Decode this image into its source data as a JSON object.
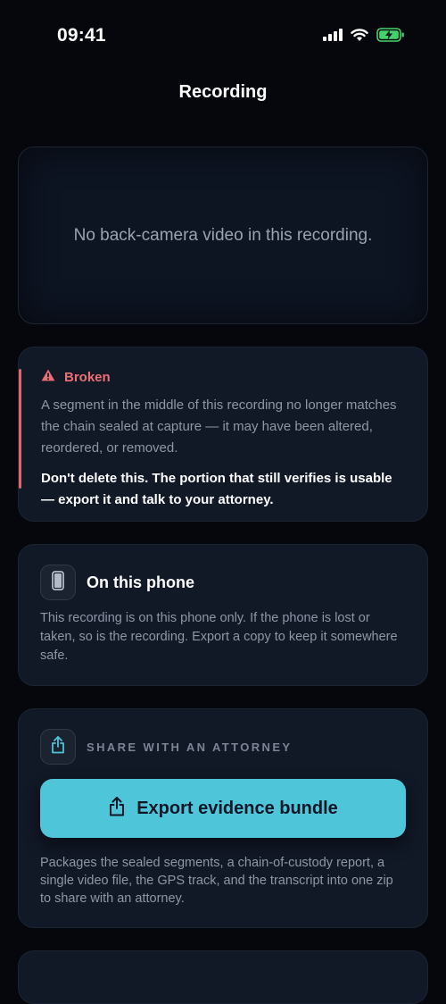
{
  "status_bar": {
    "time": "09:41",
    "icons": [
      "cellular-signal-icon",
      "wifi-icon",
      "battery-charging-icon"
    ]
  },
  "nav": {
    "title": "Recording"
  },
  "video": {
    "message": "No back-camera video in this recording."
  },
  "integrity": {
    "status_label": "Broken",
    "status_icon": "warning-triangle-icon",
    "status_color": "#ec6f76",
    "description": "A segment in the middle of this recording no longer matches the chain sealed at capture — it may have been altered, reordered, or removed.",
    "advice": "Don't delete this. The portion that still verifies is usable — export it and talk to your attorney."
  },
  "storage": {
    "icon": "phone-icon",
    "title": "On this phone",
    "description": "This recording is on this phone only. If the phone is lost or taken, so is the recording. Export a copy to keep it somewhere safe."
  },
  "share": {
    "icon": "share-icon",
    "kicker": "SHARE WITH AN ATTORNEY",
    "button_label": "Export evidence bundle",
    "button_color": "#4ec5d8",
    "description": "Packages the sealed segments, a chain-of-custody report, a single video file, the GPS track, and the transcript into one zip to share with an attorney."
  }
}
